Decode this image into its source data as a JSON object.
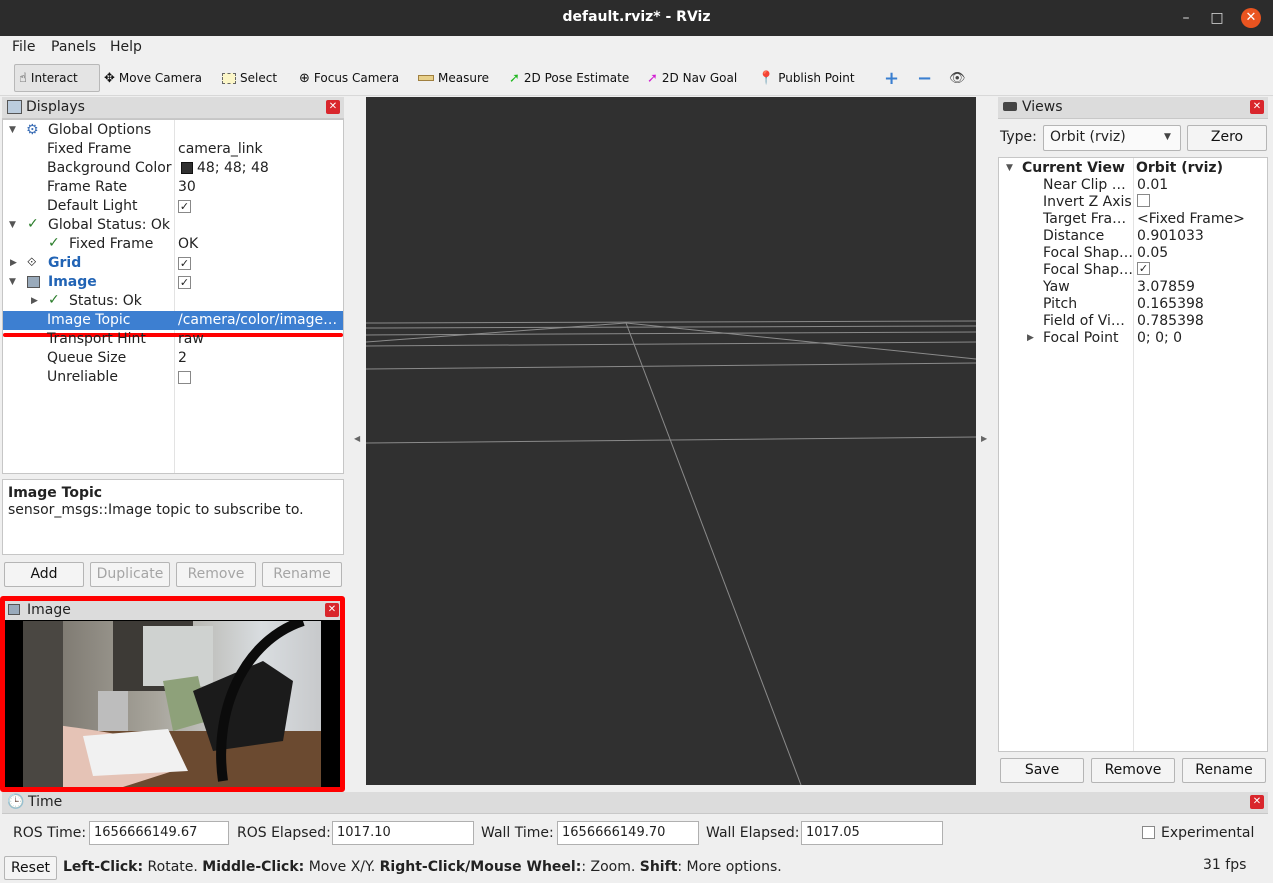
{
  "window": {
    "title": "default.rviz* - RViz",
    "minimize_glyph": "–",
    "maximize_glyph": "□",
    "close_glyph": "✕"
  },
  "menu": [
    {
      "label": "File"
    },
    {
      "label": "Panels"
    },
    {
      "label": "Help"
    }
  ],
  "toolbar": {
    "tools": [
      {
        "label": "Interact",
        "icon": "hand-icon"
      },
      {
        "label": "Move Camera",
        "icon": "move-icon"
      },
      {
        "label": "Select",
        "icon": "select-box-icon"
      },
      {
        "label": "Focus Camera",
        "icon": "focus-icon"
      },
      {
        "label": "Measure",
        "icon": "ruler-icon"
      },
      {
        "label": "2D Pose Estimate",
        "icon": "green-arrow-icon"
      },
      {
        "label": "2D Nav Goal",
        "icon": "magenta-arrow-icon"
      },
      {
        "label": "Publish Point",
        "icon": "map-pin-icon"
      }
    ],
    "plus": "+",
    "minus": "−",
    "eye": "👁"
  },
  "displays": {
    "title": "Displays",
    "rows": {
      "global_options": "Global Options",
      "fixed_frame": {
        "label": "Fixed Frame",
        "value": "camera_link"
      },
      "background_color": {
        "label": "Background Color",
        "value": "48; 48; 48"
      },
      "frame_rate": {
        "label": "Frame Rate",
        "value": "30"
      },
      "default_light": {
        "label": "Default Light",
        "checked": true
      },
      "global_status": "Global Status: Ok",
      "gs_fixed_frame": {
        "label": "Fixed Frame",
        "value": "OK"
      },
      "grid": {
        "label": "Grid",
        "checked": true
      },
      "image": {
        "label": "Image",
        "checked": true
      },
      "status": "Status: Ok",
      "image_topic": {
        "label": "Image Topic",
        "value": "/camera/color/image…"
      },
      "transport_hint": {
        "label": "Transport Hint",
        "value": "raw"
      },
      "queue_size": {
        "label": "Queue Size",
        "value": "2"
      },
      "unreliable": {
        "label": "Unreliable",
        "checked": false
      }
    },
    "check_glyph": "✓",
    "description": {
      "title": "Image Topic",
      "text": "sensor_msgs::Image topic to subscribe to."
    },
    "buttons": {
      "add": "Add",
      "duplicate": "Duplicate",
      "remove": "Remove",
      "rename": "Rename"
    }
  },
  "image_panel": {
    "title": "Image"
  },
  "views": {
    "title": "Views",
    "type_label": "Type:",
    "type_value": "Orbit (rviz)",
    "zero": "Zero",
    "current_view": {
      "label": "Current View",
      "value": "Orbit (rviz)"
    },
    "rows": [
      {
        "label": "Near Clip …",
        "value": "0.01"
      },
      {
        "label": "Invert Z Axis",
        "value": ""
      },
      {
        "label": "Target Fra…",
        "value": "<Fixed Frame>"
      },
      {
        "label": "Distance",
        "value": "0.901033"
      },
      {
        "label": "Focal Shap…",
        "value": "0.05"
      },
      {
        "label": "Focal Shap…",
        "value": ""
      },
      {
        "label": "Yaw",
        "value": "3.07859"
      },
      {
        "label": "Pitch",
        "value": "0.165398"
      },
      {
        "label": "Field of Vi…",
        "value": "0.785398"
      },
      {
        "label": "Focal Point",
        "value": "0; 0; 0"
      }
    ],
    "invert_z_checked": false,
    "focal_shape_fixed_checked": true,
    "buttons": {
      "save": "Save",
      "remove": "Remove",
      "rename": "Rename"
    }
  },
  "time": {
    "title": "Time",
    "ros_time_label": "ROS Time:",
    "ros_time": "1656666149.67",
    "ros_elapsed_label": "ROS Elapsed:",
    "ros_elapsed": "1017.10",
    "wall_time_label": "Wall Time:",
    "wall_time": "1656666149.70",
    "wall_elapsed_label": "Wall Elapsed:",
    "wall_elapsed": "1017.05",
    "experimental": "Experimental",
    "experimental_checked": false
  },
  "statusbar": {
    "reset": "Reset",
    "hint_parts": [
      {
        "bold": "Left-Click:",
        "text": " Rotate. "
      },
      {
        "bold": "Middle-Click:",
        "text": " Move X/Y. "
      },
      {
        "bold": "Right-Click/Mouse Wheel:",
        "text": ": Zoom. "
      },
      {
        "bold": "Shift",
        "text": ": More options."
      }
    ],
    "fps": "31 fps"
  },
  "colors": {
    "accent_selection": "#3d7fd1",
    "highlight_red": "#ff0000",
    "viewport_bg": "#303030",
    "ubuntu_orange": "#e95420"
  }
}
